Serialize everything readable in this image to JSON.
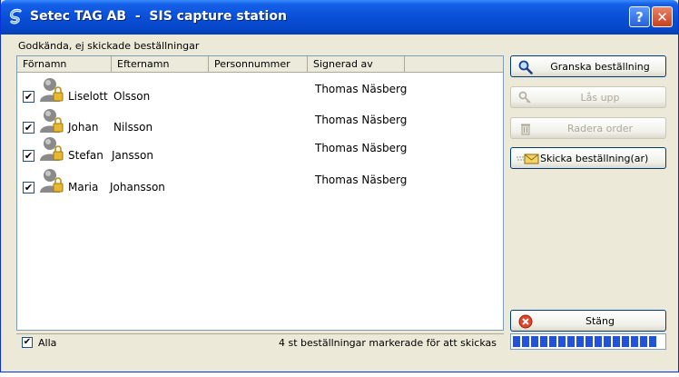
{
  "window": {
    "title": "Setec TAG AB  -  SIS capture station",
    "help_symbol": "?",
    "close_symbol": "✕"
  },
  "group_label": "Godkända, ej skickade beställningar",
  "list": {
    "columns": [
      "Förnamn",
      "Efternamn",
      "Personnummer",
      "Signerad av"
    ],
    "rows": [
      {
        "checked": "✔",
        "first": "Liselott",
        "last": "Olsson",
        "signed_by": "Thomas Näsberg"
      },
      {
        "checked": "✔",
        "first": "Johan",
        "last": "Nilsson",
        "signed_by": "Thomas Näsberg"
      },
      {
        "checked": "✔",
        "first": "Stefan",
        "last": "Jansson",
        "signed_by": "Thomas Näsberg"
      },
      {
        "checked": "✔",
        "first": "Maria",
        "last": "Johansson",
        "signed_by": "Thomas Näsberg"
      }
    ]
  },
  "footer": {
    "all_checked": "✔",
    "all_label": "Alla",
    "status": "4 st beställningar markerade för att skickas"
  },
  "buttons": {
    "review": "Granska beställning",
    "unlock": "Lås upp",
    "delete": "Radera order",
    "send": "Skicka beställning(ar)",
    "close": "Stäng"
  },
  "progress": {
    "fraction": 1.0
  },
  "icons": {
    "app": "setec-logo-icon",
    "person": "person-lock-icon",
    "review": "magnifier-icon",
    "unlock": "key-icon",
    "delete": "trash-icon",
    "send": "envelope-icon",
    "close": "red-x-icon"
  },
  "colors": {
    "titlebar": "#0A4FD8",
    "window_bg": "#ECE9D8",
    "progress": "#2152D9"
  }
}
